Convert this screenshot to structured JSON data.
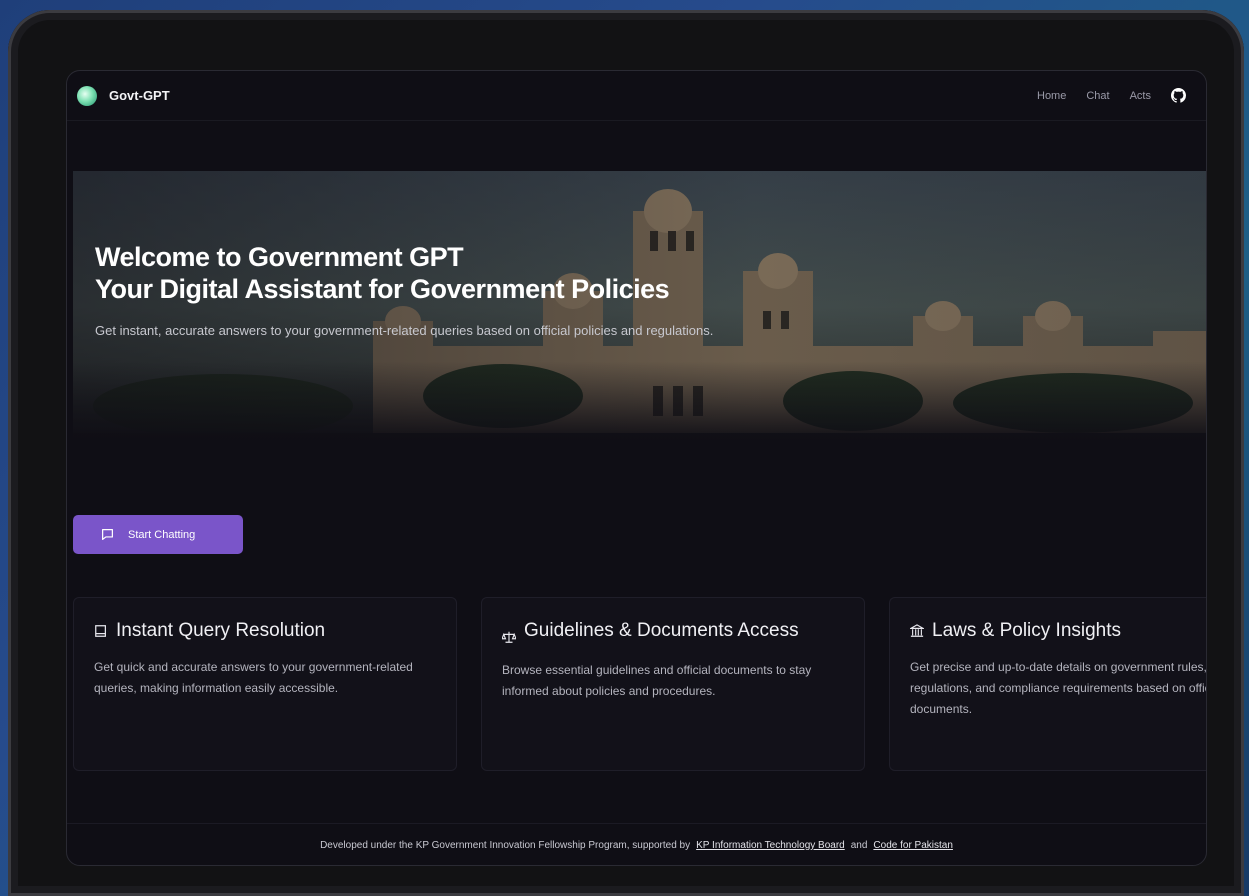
{
  "navbar": {
    "brand": "Govt-GPT",
    "links": [
      "Home",
      "Chat",
      "Acts"
    ],
    "github_icon": "github-icon"
  },
  "hero": {
    "title_line1": "Welcome to Government GPT",
    "title_line2": "Your Digital Assistant for Government Policies",
    "subtitle": "Get instant, accurate answers to your government-related queries based on official policies and regulations."
  },
  "cta": {
    "label": "Start Chatting",
    "icon": "chat-bubble-icon",
    "color": "#7a55c9"
  },
  "cards": [
    {
      "icon": "book-icon",
      "title": "Instant Query Resolution",
      "body": "Get quick and accurate answers to your government-related queries, making information easily accessible."
    },
    {
      "icon": "scale-icon",
      "title": "Guidelines & Documents Access",
      "body": "Browse essential guidelines and official documents to stay informed about policies and procedures."
    },
    {
      "icon": "landmark-icon",
      "title": "Laws & Policy Insights",
      "body": "Get precise and up-to-date details on government rules, regulations, and compliance requirements based on official documents."
    }
  ],
  "footer": {
    "text": "Developed under the KP Government Innovation Fellowship Program, supported by",
    "link1": "KP Information Technology Board",
    "and": "and",
    "link2": "Code for Pakistan"
  }
}
